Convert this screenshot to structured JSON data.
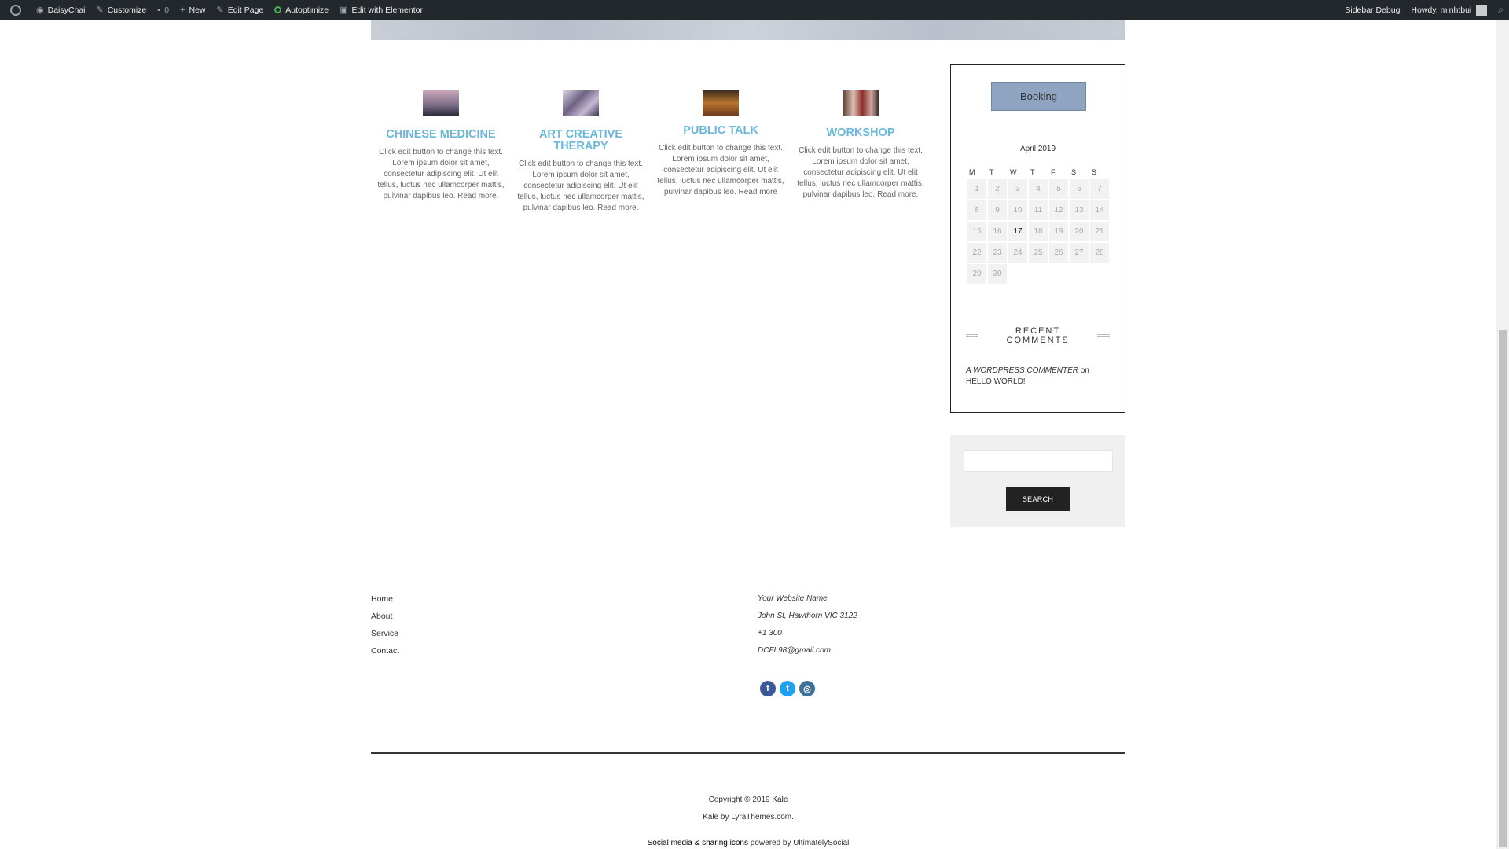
{
  "adminbar": {
    "site_name": "DaisyChai",
    "customize": "Customize",
    "comments_count": "0",
    "new": "New",
    "edit_page": "Edit Page",
    "autoptimize": "Autoptimize",
    "edit_elementor": "Edit with Elementor",
    "sidebar_debug": "Sidebar Debug",
    "howdy": "Howdy, minhtbui"
  },
  "services": [
    {
      "title": "CHINESE MEDICINE",
      "text": "Click edit button to change this text. Lorem ipsum dolor sit amet, consectetur adipiscing elit. Ut elit tellus, luctus nec ullamcorper mattis, pulvinar dapibus leo.",
      "more": "Read more."
    },
    {
      "title": "ART CREATIVE THERAPY",
      "text": "Click edit button to change this text. Lorem ipsum dolor sit amet, consectetur adipiscing elit. Ut elit tellus, luctus nec ullamcorper mattis, pulvinar dapibus leo.",
      "more": "Read more."
    },
    {
      "title": "PUBLIC TALK",
      "text": "Click edit button to change this text. Lorem ipsum dolor sit amet, consectetur adipiscing elit. Ut elit tellus, luctus nec ullamcorper mattis, pulvinar dapibus leo.",
      "more": "Read more"
    },
    {
      "title": "WORKSHOP",
      "text": "Click edit button to change this text. Lorem ipsum dolor sit amet, consectetur adipiscing elit. Ut elit tellus, luctus nec ullamcorper mattis, pulvinar dapibus leo.",
      "more": "Read more."
    }
  ],
  "sidebar": {
    "booking_label": "Booking",
    "calendar": {
      "caption": "April 2019",
      "weekdays": [
        "M",
        "T",
        "W",
        "T",
        "F",
        "S",
        "S"
      ],
      "weeks": [
        [
          "1",
          "2",
          "3",
          "4",
          "5",
          "6",
          "7"
        ],
        [
          "8",
          "9",
          "10",
          "11",
          "12",
          "13",
          "14"
        ],
        [
          "15",
          "16",
          "17",
          "18",
          "19",
          "20",
          "21"
        ],
        [
          "22",
          "23",
          "24",
          "25",
          "26",
          "27",
          "28"
        ],
        [
          "29",
          "30",
          "",
          "",
          "",
          "",
          ""
        ]
      ],
      "today": "17"
    },
    "recent_comments_title": "RECENT COMMENTS",
    "comment_author": "A WORDPRESS COMMENTER",
    "comment_on": "on",
    "comment_post": "HELLO WORLD!",
    "search_button": "SEARCH"
  },
  "footer": {
    "links": [
      "Home",
      "About",
      "Service",
      "Contact"
    ],
    "contact": {
      "name": "Your Website Name",
      "address": "John St, Hawthorn VIC 3122",
      "phone": "+1 300",
      "email": "DCFL98@gmail.com"
    },
    "copyright_prefix": "Copyright © 2019",
    "copyright_name": "Kale",
    "theme_credit": "Kale by LyraThemes.com.",
    "social_credit_link": "Social media & sharing icons",
    "social_credit_rest": "powered by UltimatelySocial"
  }
}
